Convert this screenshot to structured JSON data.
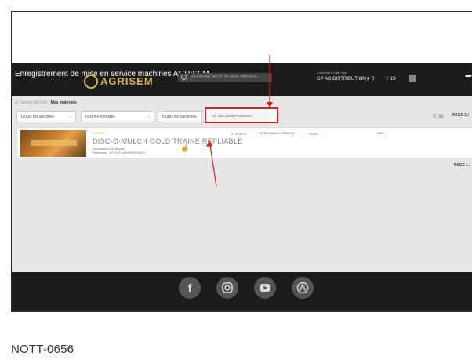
{
  "header": {
    "title": "Enregistrement de mise en service machines AGRISEM",
    "logo_text": "AGRISEM",
    "search_placeholder": "Rechercher par N° de série, référence...",
    "user_small": "Connecté en tant que",
    "user": "GP AG DISTRIBUTION ▾",
    "cart": "🛒 0",
    "favorites": "♡ 19"
  },
  "breadcrumb": {
    "home_icon": "home-icon",
    "parent": "Tableau de bord",
    "separator": "/",
    "current": "Mes matériels"
  },
  "filters": {
    "ranges": "Toutes les gammes",
    "models": "Tous les modèles",
    "warranties": "Toutes les garanties",
    "serial_value": "AR DSC1649HP5000010"
  },
  "pagination": {
    "top": "PAGE 1 /",
    "bottom": "PAGE 1 /"
  },
  "product": {
    "brand": "Agrisem",
    "name": "DISC-O-MULCH GOLD TRAINE REPLIABLE",
    "sub1": "Déchaumeur à disques",
    "sub2": "Référence : AR DSC1649HP5000010",
    "serial_label": "N° de série",
    "serial_value": "AR DSC1649HP5000010",
    "year_label": "Année",
    "year_value": "2021"
  },
  "caption": "NOTT-0656",
  "colors": {
    "highlight": "#e0201e",
    "brand_gold": "#d9b24a",
    "header_bg": "#1c1c1c"
  },
  "social": [
    "facebook-icon",
    "instagram-icon",
    "youtube-icon",
    "agrisem-icon"
  ]
}
